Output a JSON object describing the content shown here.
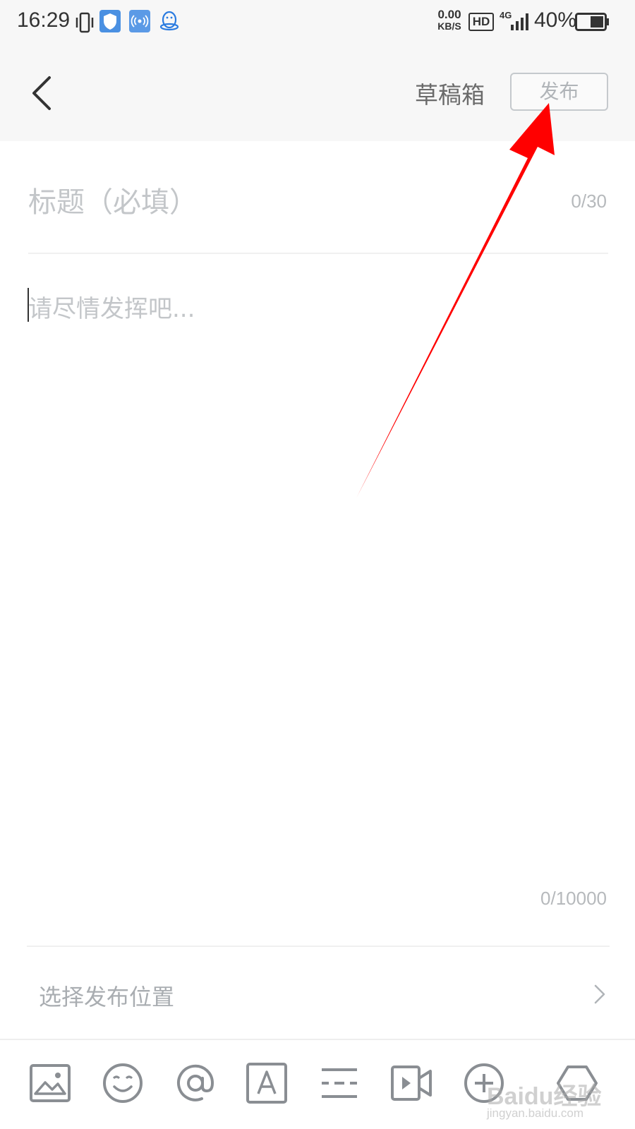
{
  "status_bar": {
    "time": "16:29",
    "net_speed_value": "0.00",
    "net_speed_unit": "KB/S",
    "hd_label": "HD",
    "network_label": "4G",
    "battery_percent": "40%",
    "icons": [
      "vibrate-icon",
      "shield-icon",
      "broadcast-icon",
      "qq-penguin-icon",
      "hd-icon",
      "signal-icon",
      "battery-icon"
    ]
  },
  "nav": {
    "back_icon": "back-chevron-icon",
    "drafts_label": "草稿箱",
    "publish_label": "发布"
  },
  "editor": {
    "title_placeholder": "标题（必填）",
    "title_count": "0/30",
    "content_placeholder": "请尽情发挥吧...",
    "content_count": "0/10000"
  },
  "location": {
    "label": "选择发布位置",
    "chevron_icon": "chevron-right-icon"
  },
  "toolbar": {
    "items": [
      "image-icon",
      "emoji-icon",
      "mention-icon",
      "text-format-icon",
      "divider-icon",
      "video-icon",
      "add-icon",
      "more-icon"
    ]
  },
  "watermark": {
    "brand": "Baidu经验",
    "url": "jingyan.baidu.com"
  },
  "colors": {
    "annotation_arrow": "#ff0000",
    "nav_background": "#f7f7f7",
    "icon_gray": "#8a8e93",
    "placeholder_gray": "#c3c6c9"
  }
}
